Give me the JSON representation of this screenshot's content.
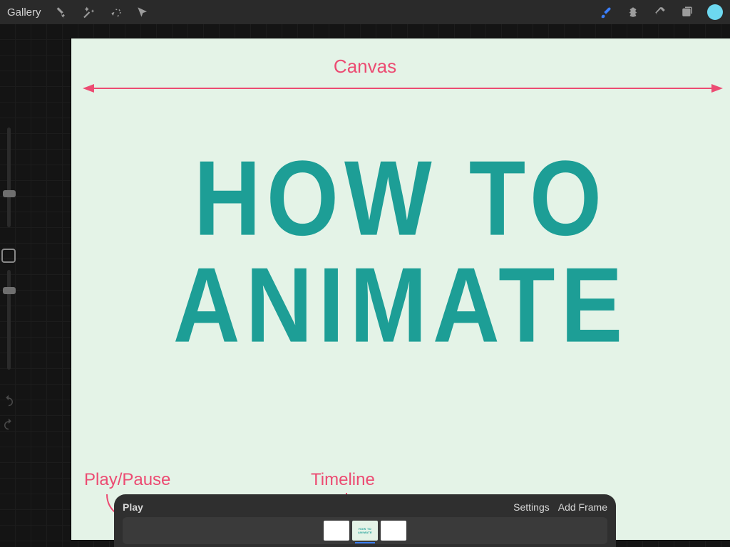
{
  "toolbar": {
    "gallery_label": "Gallery"
  },
  "canvas": {
    "line1": "HOW TO",
    "line2": "ANIMATE"
  },
  "annotations": {
    "canvas": "Canvas",
    "timeline": "Timeline",
    "play_pause": "Play/Pause"
  },
  "timeline": {
    "play_label": "Play",
    "settings_label": "Settings",
    "add_frame_label": "Add Frame",
    "frame_mini_line1": "HOW TO",
    "frame_mini_line2": "ANIMATE"
  },
  "colors": {
    "accent_pink": "#ec4b72",
    "accent_teal": "#1d9e96",
    "accent_blue": "#3b7fff"
  }
}
